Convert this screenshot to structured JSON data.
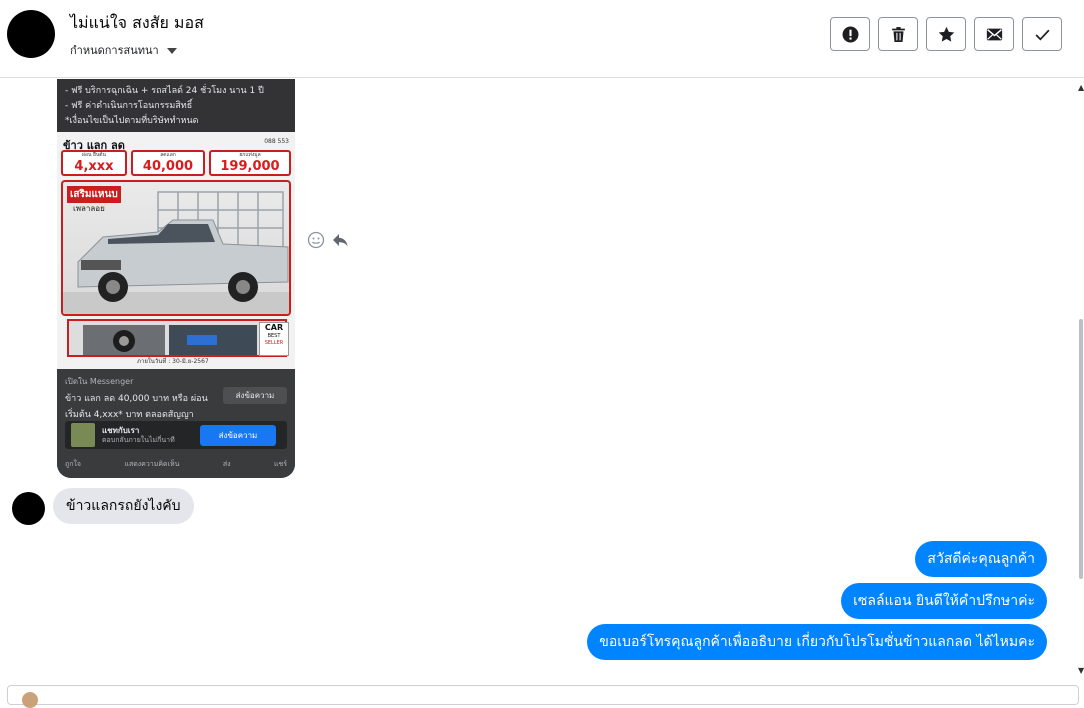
{
  "header": {
    "contact_name": "ไม่แน่ใจ สงสัย มอส",
    "label_dropdown": "กำหนดการสนทนา"
  },
  "toolbar": {
    "buttons": [
      {
        "name": "report-button",
        "icon": "alert-icon"
      },
      {
        "name": "delete-button",
        "icon": "trash-icon"
      },
      {
        "name": "star-button",
        "icon": "star-icon"
      },
      {
        "name": "mark-unread-button",
        "icon": "envelope-icon"
      },
      {
        "name": "done-button",
        "icon": "check-icon"
      }
    ]
  },
  "ad": {
    "lines": [
      "- ฟรี บริการฉุกเฉิน + รถสไลด์ 24 ชั่วโมง นาน 1 ปี",
      "- ฟรี ค่าดำเนินการโอนกรรมสิทธิ์",
      "*เงื่อนไขเป็นไปตามที่บริษัททำหนด"
    ],
    "banner_title": "ข้าว แลก ลด",
    "phone": "088 553",
    "prices": [
      {
        "caption": "ผ่อน ยืนต้น",
        "value": "4,xxx"
      },
      {
        "caption": "ลดแลก",
        "value": "40,000"
      },
      {
        "caption": "ยกแท่งมูล",
        "value": "199,000"
      }
    ],
    "promo_label": "เสริมแหนบ",
    "promo_sub": "เพลาลอย",
    "badge_line1": "CAR",
    "badge_line2": "BEST",
    "badge_line3": "SELLER",
    "footer_small": "ภายในวันที่ : 30-มิ.ย-2567",
    "via": "เปิดใน Messenger",
    "text_line1": "ข้าว แลก ลด 40,000 บาท หรือ ผ่อน",
    "text_line2": "เริ่มต้น 4,xxx* บาท ตลอดสัญญา",
    "send_pill": "ส่งข้อความ",
    "messenger_title": "แชทกับเรา",
    "messenger_sub": "ตอบกลับภายในไม่กี่นาที",
    "messenger_button": "ส่งข้อความ",
    "actions": [
      "ถูกใจ",
      "แสดงความคิดเห็น",
      "ส่ง",
      "แชร์"
    ]
  },
  "messages": {
    "incoming": [
      {
        "text": "ข้าวแลกรถยังไงคับ"
      }
    ],
    "outgoing": [
      {
        "text": "สวัสดีค่ะคุณลูกค้า"
      },
      {
        "text": "เซลล์แอน ยินดีให้คำปรึกษาค่ะ"
      },
      {
        "text": "ขอเบอร์โทรคุณลูกค้าเพื่ออธิบาย เกี่ยวกับโปรโมชั่นข้าวแลกลด ได้ไหมคะ"
      }
    ]
  },
  "colors": {
    "outgoing_bubble": "#0084ff",
    "incoming_bubble": "#e4e6eb",
    "messenger_blue": "#1877f2",
    "price_red": "#d81b1b"
  }
}
